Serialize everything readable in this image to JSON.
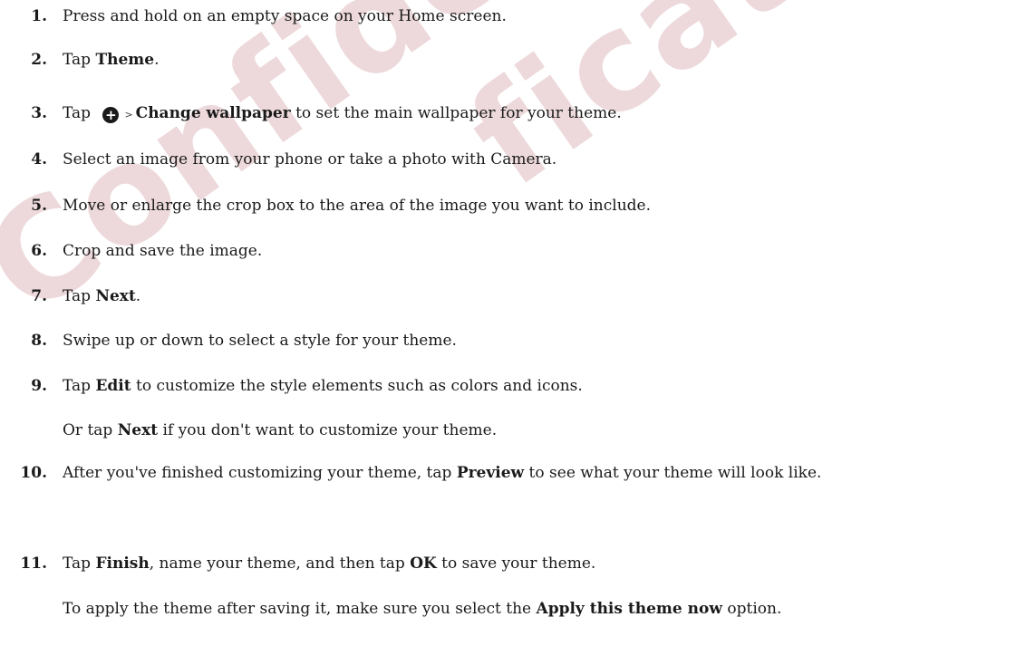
{
  "watermark": {
    "line1": "Confidential",
    "line2": "fication only"
  },
  "steps": [
    {
      "num": "1.",
      "parts": [
        {
          "t": "Press and hold on an empty space on your Home screen."
        }
      ]
    },
    {
      "num": "2.",
      "parts": [
        {
          "t": "Tap "
        },
        {
          "b": "Theme"
        },
        {
          "t": "."
        }
      ]
    },
    {
      "num": "3.",
      "parts": [
        {
          "t": "Tap "
        },
        {
          "icon": "plus-circle-icon"
        },
        {
          "gt": ">"
        },
        {
          "b": "Change wallpaper"
        },
        {
          "t": " to set the main wallpaper for your theme."
        }
      ]
    },
    {
      "num": "4.",
      "parts": [
        {
          "t": "Select an image from your phone or take a photo with Camera."
        }
      ]
    },
    {
      "num": "5.",
      "parts": [
        {
          "t": "Move or enlarge the crop box to the area of the image you want to include."
        }
      ]
    },
    {
      "num": "6.",
      "parts": [
        {
          "t": "Crop and save the image."
        }
      ]
    },
    {
      "num": "7.",
      "parts": [
        {
          "t": "Tap "
        },
        {
          "b": "Next"
        },
        {
          "t": "."
        }
      ]
    },
    {
      "num": "8.",
      "parts": [
        {
          "t": "Swipe up or down to select a style for your theme."
        }
      ]
    },
    {
      "num": "9.",
      "parts": [
        {
          "t": "Tap "
        },
        {
          "b": "Edit"
        },
        {
          "t": " to customize the style elements such as colors and icons."
        }
      ]
    },
    {
      "num": "10.",
      "parts": [
        {
          "t": "After you've finished customizing your theme, tap "
        },
        {
          "b": "Preview"
        },
        {
          "t": " to see what your theme will look like."
        }
      ]
    },
    {
      "num": "11.",
      "parts": [
        {
          "t": "Tap "
        },
        {
          "b": "Finish"
        },
        {
          "t": ", name your theme, and then tap "
        },
        {
          "b": "OK"
        },
        {
          "t": " to save your theme."
        }
      ]
    }
  ],
  "notes": [
    {
      "after": "9.",
      "parts": [
        {
          "t": "Or tap "
        },
        {
          "b": "Next"
        },
        {
          "t": " if you don't want to customize your theme."
        }
      ]
    },
    {
      "after": "11.",
      "parts": [
        {
          "t": "To apply the theme after saving it, make sure you select the "
        },
        {
          "b": "Apply this theme now"
        },
        {
          "t": " option."
        }
      ]
    }
  ]
}
